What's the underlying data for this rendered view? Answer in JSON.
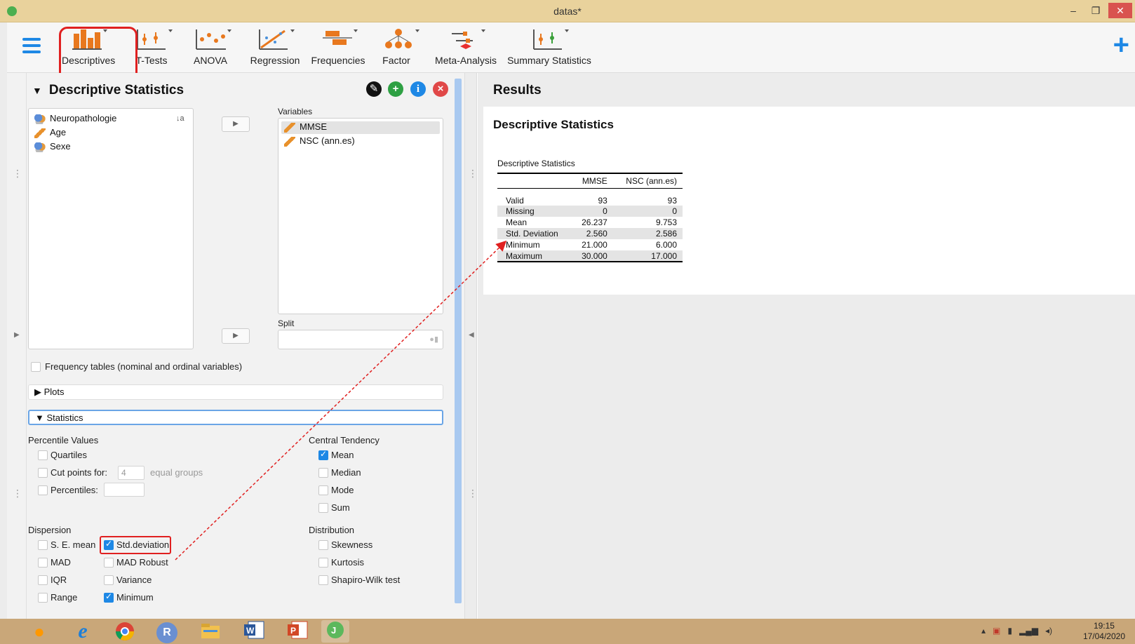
{
  "window": {
    "title": "datas*",
    "minimize": "–",
    "restore": "❐",
    "close": "✕"
  },
  "ribbon": {
    "items": [
      {
        "label": "Descriptives"
      },
      {
        "label": "T-Tests"
      },
      {
        "label": "ANOVA"
      },
      {
        "label": "Regression"
      },
      {
        "label": "Frequencies"
      },
      {
        "label": "Factor"
      },
      {
        "label": "Meta-Analysis"
      },
      {
        "label": "Summary Statistics"
      }
    ],
    "add_label": "+"
  },
  "panel": {
    "title": "Descriptive Statistics",
    "available_vars": [
      {
        "name": "Neuropathologie",
        "type": "nominal"
      },
      {
        "name": "Age",
        "type": "scale"
      },
      {
        "name": "Sexe",
        "type": "nominal"
      }
    ],
    "variables_label": "Variables",
    "variables": [
      {
        "name": "MMSE",
        "type": "scale"
      },
      {
        "name": "NSC (ann.es)",
        "type": "scale"
      }
    ],
    "split_label": "Split",
    "frequency_tables_label": "Frequency tables (nominal and ordinal variables)",
    "plots_label": "Plots",
    "statistics_label": "Statistics",
    "percentile_values": {
      "heading": "Percentile Values",
      "quartiles": "Quartiles",
      "cut_points": "Cut points for:",
      "cut_points_value": "4",
      "equal_groups": "equal groups",
      "percentiles": "Percentiles:"
    },
    "central_tendency": {
      "heading": "Central Tendency",
      "mean": "Mean",
      "median": "Median",
      "mode": "Mode",
      "sum": "Sum"
    },
    "dispersion": {
      "heading": "Dispersion",
      "se_mean": "S. E. mean",
      "std_deviation": "Std.deviation",
      "mad": "MAD",
      "mad_robust": "MAD Robust",
      "iqr": "IQR",
      "variance": "Variance",
      "range": "Range",
      "minimum": "Minimum"
    },
    "distribution": {
      "heading": "Distribution",
      "skewness": "Skewness",
      "kurtosis": "Kurtosis",
      "shapiro": "Shapiro-Wilk test"
    }
  },
  "results": {
    "title": "Results",
    "card_title": "Descriptive Statistics",
    "table": {
      "caption": "Descriptive Statistics",
      "columns": [
        "",
        "MMSE",
        "NSC (ann.es)"
      ],
      "rows": [
        [
          "Valid",
          "93",
          "93"
        ],
        [
          "Missing",
          "0",
          "0"
        ],
        [
          "Mean",
          "26.237",
          "9.753"
        ],
        [
          "Std. Deviation",
          "2.560",
          "2.586"
        ],
        [
          "Minimum",
          "21.000",
          "6.000"
        ],
        [
          "Maximum",
          "30.000",
          "17.000"
        ]
      ]
    }
  },
  "taskbar": {
    "apps": [
      "R"
    ],
    "clock_time": "19:15",
    "clock_date": "17/04/2020"
  },
  "colors": {
    "accent": "#1e88e5",
    "annotation": "#e02020",
    "titlebar": "#e9d29c"
  }
}
